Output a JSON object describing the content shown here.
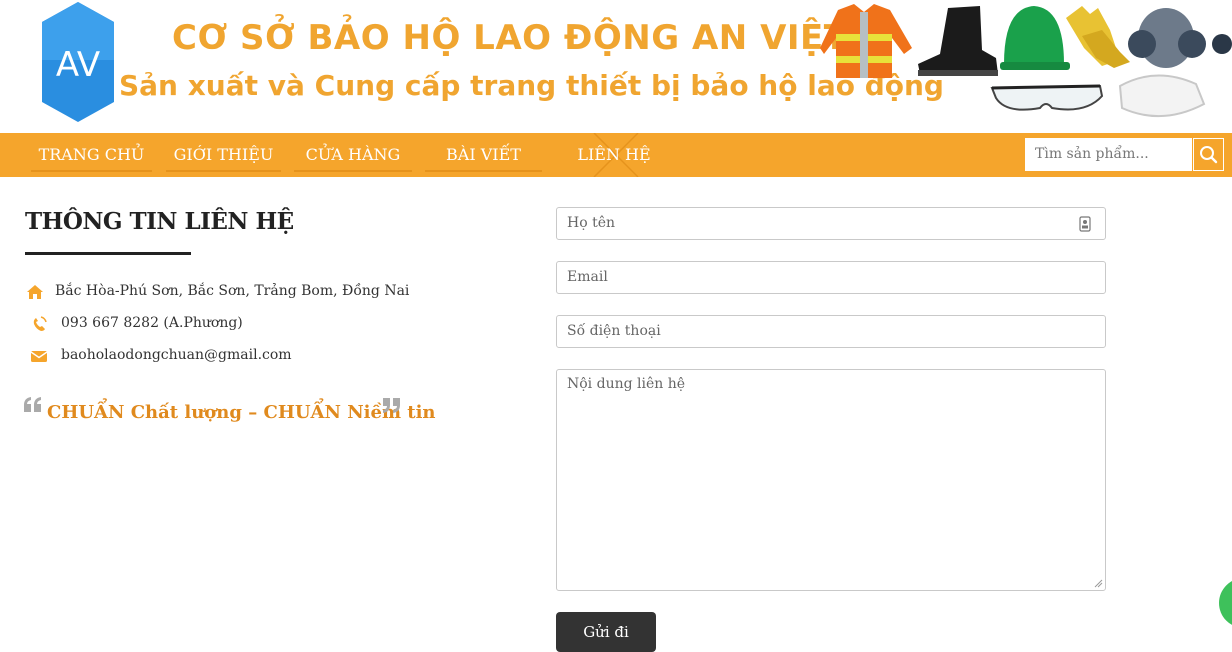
{
  "header": {
    "logo_text": "AV",
    "title": "CƠ SỞ BẢO HỘ LAO ĐỘNG AN VIỆT",
    "subtitle": "Sản xuất và Cung cấp trang thiết bị bảo hộ lao động",
    "product_images": [
      "reflective-vest",
      "safety-boot",
      "hard-hat",
      "work-gloves",
      "respirator-mask",
      "safety-glasses",
      "dust-mask"
    ]
  },
  "nav": {
    "items": [
      {
        "label": "TRANG CHỦ"
      },
      {
        "label": "GIỚI THIỆU"
      },
      {
        "label": "CỬA HÀNG"
      },
      {
        "label": "BÀI VIẾT"
      },
      {
        "label": "LIÊN HỆ"
      }
    ],
    "search_placeholder": "Tìm sản phẩm...",
    "search_icon": "search-icon"
  },
  "contact": {
    "title": "THÔNG TIN LIÊN HỆ",
    "address": "Bắc Hòa-Phú Sơn, Bắc Sơn, Trảng Bom, Đồng Nai",
    "phone": "093 667 8282 (A.Phương)",
    "email": "baoholaodongchuan@gmail.com",
    "quote": "CHUẨN Chất lượng – CHUẨN Niềm tin"
  },
  "form": {
    "name_placeholder": "Họ tên",
    "email_placeholder": "Email",
    "phone_placeholder": "Số điện thoại",
    "message_placeholder": "Nội dung liên hệ",
    "submit_label": "Gửi đi"
  },
  "colors": {
    "accent": "#f5a52c",
    "brand_text": "#f0a530",
    "logo_blue": "#1f7fd1",
    "button_dark": "#333333",
    "chat_green": "#3ec15b"
  }
}
